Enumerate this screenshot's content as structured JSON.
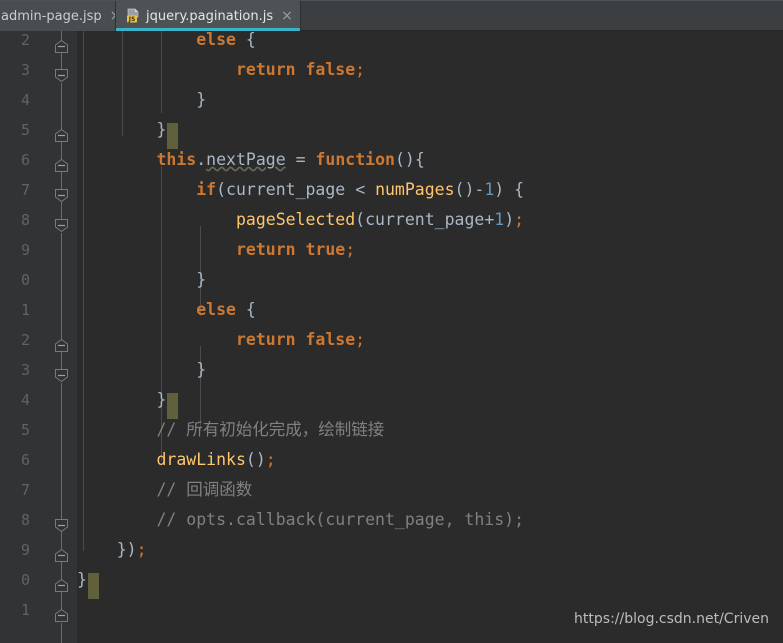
{
  "window": {
    "app": "IntelliJ IDEA Code Editor",
    "background_color": "#2b2b2b",
    "gutter_color": "#313335",
    "tabbar_color": "#3c3f41",
    "accent_color": "#3ab3c9",
    "highlight_color": "#61603d"
  },
  "tabs": [
    {
      "label": "admin-page.jsp",
      "icon": "jsp-file-icon",
      "close": "×",
      "active": false
    },
    {
      "label": "jquery.pagination.js",
      "icon": "js-file-icon",
      "close": "×",
      "active": true
    }
  ],
  "gutter": {
    "line_numbers": [
      "2",
      "3",
      "4",
      "5",
      "6",
      "7",
      "8",
      "9",
      "0",
      "1",
      "2",
      "3",
      "4",
      "5",
      "6",
      "7",
      "8",
      "9",
      "0",
      "1"
    ],
    "fold_icon": "fold-collapse-icon"
  },
  "code": {
    "lines": [
      {
        "n": 0,
        "indent": 0,
        "tokens": [
          {
            "t": "            ",
            "c": "ident"
          },
          {
            "t": "else",
            "c": "kw"
          },
          {
            "t": " ",
            "c": "ident"
          },
          {
            "t": "{",
            "c": "brc"
          }
        ]
      },
      {
        "n": 1,
        "indent": 0,
        "tokens": [
          {
            "t": "                ",
            "c": "ident"
          },
          {
            "t": "return",
            "c": "kw"
          },
          {
            "t": " ",
            "c": "ident"
          },
          {
            "t": "false",
            "c": "kw"
          },
          {
            "t": ";",
            "c": "punc"
          }
        ]
      },
      {
        "n": 2,
        "indent": 0,
        "tokens": [
          {
            "t": "            ",
            "c": "ident"
          },
          {
            "t": "}",
            "c": "brc"
          }
        ]
      },
      {
        "n": 3,
        "indent": 0,
        "tokens": [
          {
            "t": "        ",
            "c": "ident"
          },
          {
            "t": "}",
            "c": "brc"
          }
        ],
        "highlight": true
      },
      {
        "n": 4,
        "indent": 0,
        "tokens": [
          {
            "t": "        ",
            "c": "ident"
          },
          {
            "t": "this",
            "c": "kw"
          },
          {
            "t": ".",
            "c": "ident"
          },
          {
            "t": "nextPage",
            "c": "warn"
          },
          {
            "t": " ",
            "c": "ident"
          },
          {
            "t": "=",
            "c": "ident"
          },
          {
            "t": " ",
            "c": "ident"
          },
          {
            "t": "function",
            "c": "kw"
          },
          {
            "t": "()",
            "c": "brc"
          },
          {
            "t": "{",
            "c": "brc"
          }
        ]
      },
      {
        "n": 5,
        "indent": 0,
        "tokens": [
          {
            "t": "            ",
            "c": "ident"
          },
          {
            "t": "if",
            "c": "kw"
          },
          {
            "t": "(",
            "c": "brc"
          },
          {
            "t": "current_page",
            "c": "ident"
          },
          {
            "t": " ",
            "c": "ident"
          },
          {
            "t": "<",
            "c": "ident"
          },
          {
            "t": " ",
            "c": "ident"
          },
          {
            "t": "numPages",
            "c": "fn"
          },
          {
            "t": "()",
            "c": "brc"
          },
          {
            "t": "-",
            "c": "ident"
          },
          {
            "t": "1",
            "c": "num"
          },
          {
            "t": ")",
            "c": "brc"
          },
          {
            "t": " ",
            "c": "ident"
          },
          {
            "t": "{",
            "c": "brc"
          }
        ]
      },
      {
        "n": 6,
        "indent": 0,
        "tokens": [
          {
            "t": "                ",
            "c": "ident"
          },
          {
            "t": "pageSelected",
            "c": "fn"
          },
          {
            "t": "(",
            "c": "brc"
          },
          {
            "t": "current_page",
            "c": "ident"
          },
          {
            "t": "+",
            "c": "ident"
          },
          {
            "t": "1",
            "c": "num"
          },
          {
            "t": ")",
            "c": "brc"
          },
          {
            "t": ";",
            "c": "punc"
          }
        ]
      },
      {
        "n": 7,
        "indent": 0,
        "tokens": [
          {
            "t": "                ",
            "c": "ident"
          },
          {
            "t": "return",
            "c": "kw"
          },
          {
            "t": " ",
            "c": "ident"
          },
          {
            "t": "true",
            "c": "kw"
          },
          {
            "t": ";",
            "c": "punc"
          }
        ]
      },
      {
        "n": 8,
        "indent": 0,
        "tokens": [
          {
            "t": "            ",
            "c": "ident"
          },
          {
            "t": "}",
            "c": "brc"
          }
        ]
      },
      {
        "n": 9,
        "indent": 0,
        "tokens": [
          {
            "t": "            ",
            "c": "ident"
          },
          {
            "t": "else",
            "c": "kw"
          },
          {
            "t": " ",
            "c": "ident"
          },
          {
            "t": "{",
            "c": "brc"
          }
        ]
      },
      {
        "n": 10,
        "indent": 0,
        "tokens": [
          {
            "t": "                ",
            "c": "ident"
          },
          {
            "t": "return",
            "c": "kw"
          },
          {
            "t": " ",
            "c": "ident"
          },
          {
            "t": "false",
            "c": "kw"
          },
          {
            "t": ";",
            "c": "punc"
          }
        ]
      },
      {
        "n": 11,
        "indent": 0,
        "tokens": [
          {
            "t": "            ",
            "c": "ident"
          },
          {
            "t": "}",
            "c": "brc"
          }
        ]
      },
      {
        "n": 12,
        "indent": 0,
        "tokens": [
          {
            "t": "        ",
            "c": "ident"
          },
          {
            "t": "}",
            "c": "brc"
          }
        ],
        "highlight": true
      },
      {
        "n": 13,
        "indent": 0,
        "tokens": [
          {
            "t": "        ",
            "c": "ident"
          },
          {
            "t": "// 所有初始化完成，绘制链接",
            "c": "cmt"
          }
        ]
      },
      {
        "n": 14,
        "indent": 0,
        "tokens": [
          {
            "t": "        ",
            "c": "ident"
          },
          {
            "t": "drawLinks",
            "c": "fn"
          },
          {
            "t": "()",
            "c": "brc"
          },
          {
            "t": ";",
            "c": "punc"
          }
        ]
      },
      {
        "n": 15,
        "indent": 0,
        "tokens": [
          {
            "t": "        ",
            "c": "ident"
          },
          {
            "t": "// 回调函数",
            "c": "cmt"
          }
        ]
      },
      {
        "n": 16,
        "indent": 0,
        "tokens": [
          {
            "t": "        ",
            "c": "ident"
          },
          {
            "t": "// opts.callback(current_page, this);",
            "c": "cmt"
          }
        ]
      },
      {
        "n": 17,
        "indent": 0,
        "tokens": [
          {
            "t": "    ",
            "c": "ident"
          },
          {
            "t": "})",
            "c": "brc"
          },
          {
            "t": ";",
            "c": "punc"
          }
        ]
      },
      {
        "n": 18,
        "indent": 0,
        "tokens": [
          {
            "t": "",
            "c": "ident"
          },
          {
            "t": "}",
            "c": "brc"
          }
        ],
        "highlight": true
      }
    ]
  },
  "watermark": {
    "text": "https://blog.csdn.net/Criven"
  }
}
